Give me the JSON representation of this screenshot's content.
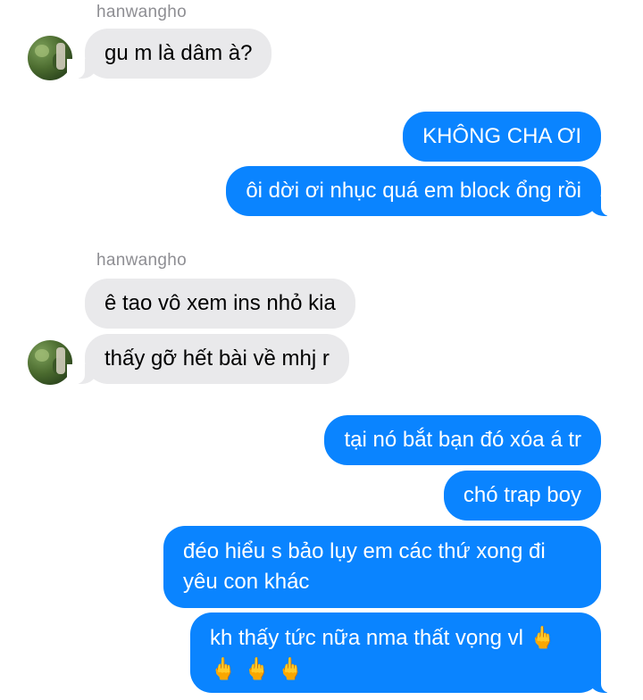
{
  "conversation": {
    "sender_1": "hanwangho",
    "sender_2": "hanwangho",
    "messages": [
      {
        "direction": "incoming",
        "text": "gu m là dâm à?"
      },
      {
        "direction": "outgoing",
        "text": "KHÔNG CHA ƠI"
      },
      {
        "direction": "outgoing",
        "text": "ôi dời ơi nhục quá em block ổng rồi"
      },
      {
        "direction": "incoming",
        "text": "ê tao vô xem ins nhỏ kia"
      },
      {
        "direction": "incoming",
        "text": "thấy gỡ hết bài về mhj r"
      },
      {
        "direction": "outgoing",
        "text": "tại nó bắt bạn đó xóa á tr"
      },
      {
        "direction": "outgoing",
        "text": "chó trap boy"
      },
      {
        "direction": "outgoing",
        "text": "đéo hiểu s bảo lụy em các thứ xong đi yêu con khác"
      },
      {
        "direction": "outgoing",
        "text": "kh thấy tức nữa nma thất vọng vl",
        "emoji": "🖕",
        "emoji_line": "🖕 🖕 🖕"
      }
    ]
  },
  "icons": {
    "avatar": "contact-avatar",
    "emoji": "middle-finger-emoji"
  },
  "colors": {
    "outgoing_bubble": "#0a84ff",
    "incoming_bubble": "#e9e9eb",
    "sender_label": "#8e8e93"
  }
}
